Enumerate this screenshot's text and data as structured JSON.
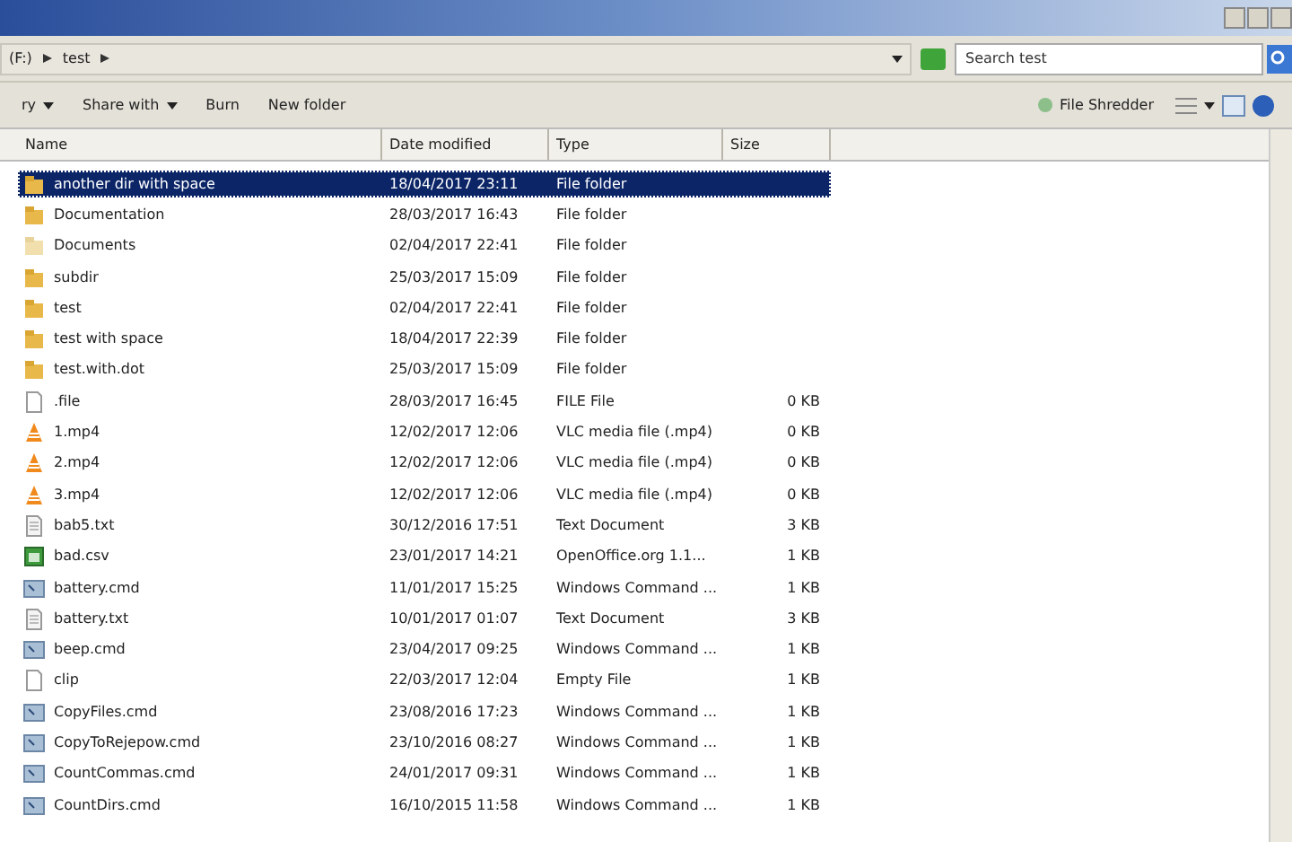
{
  "address": {
    "segments": [
      "(F:)",
      "test"
    ]
  },
  "search": {
    "placeholder": "Search test"
  },
  "toolbar": {
    "left": [
      {
        "label": "ry",
        "dropdown": true
      },
      {
        "label": "Share with",
        "dropdown": true
      },
      {
        "label": "Burn",
        "dropdown": false
      },
      {
        "label": "New folder",
        "dropdown": false
      }
    ],
    "right_label": "File Shredder"
  },
  "columns": [
    "Name",
    "Date modified",
    "Type",
    "Size"
  ],
  "rows": [
    {
      "kind": "folder",
      "name": "another dir with space",
      "date": "18/04/2017 23:11",
      "type": "File folder",
      "selected": true
    },
    {
      "kind": "folder",
      "name": "Documentation",
      "date": "28/03/2017 16:43",
      "type": "File folder",
      "selected": false
    },
    {
      "kind": "folder-light",
      "name": "Documents",
      "date": "02/04/2017 22:41",
      "type": "File folder",
      "selected": false
    },
    {
      "kind": "folder",
      "name": "subdir",
      "date": "25/03/2017 15:09",
      "type": "File folder",
      "selected": false
    },
    {
      "kind": "folder",
      "name": "test",
      "date": "02/04/2017 22:41",
      "type": "File folder",
      "selected": false
    },
    {
      "kind": "folder",
      "name": "test with space",
      "date": "18/04/2017 22:39",
      "type": "File folder",
      "selected": false
    },
    {
      "kind": "folder",
      "name": "test.with.dot",
      "date": "25/03/2017 15:09",
      "type": "File folder",
      "selected": false
    },
    {
      "kind": "file",
      "name": ".file",
      "date": "28/03/2017 16:45",
      "type": "FILE File",
      "size": "0 KB",
      "selected": false
    },
    {
      "kind": "video",
      "name": "1.mp4",
      "date": "12/02/2017 12:06",
      "type": "VLC media file (.mp4)",
      "size": "0 KB",
      "selected": false
    },
    {
      "kind": "video",
      "name": "2.mp4",
      "date": "12/02/2017 12:06",
      "type": "VLC media file (.mp4)",
      "size": "0 KB",
      "selected": false
    },
    {
      "kind": "video",
      "name": "3.mp4",
      "date": "12/02/2017 12:06",
      "type": "VLC media file (.mp4)",
      "size": "0 KB",
      "selected": false
    },
    {
      "kind": "text",
      "name": "bab5.txt",
      "date": "30/12/2016 17:51",
      "type": "Text Document",
      "size": "3 KB",
      "selected": false
    },
    {
      "kind": "spreadsheet",
      "name": "bad.csv",
      "date": "23/01/2017 14:21",
      "type": "OpenOffice.org 1.1...",
      "size": "1 KB",
      "selected": false
    },
    {
      "kind": "script",
      "name": "battery.cmd",
      "date": "11/01/2017 15:25",
      "type": "Windows Command ...",
      "size": "1 KB",
      "selected": false
    },
    {
      "kind": "text",
      "name": "battery.txt",
      "date": "10/01/2017 01:07",
      "type": "Text Document",
      "size": "3 KB",
      "selected": false
    },
    {
      "kind": "script",
      "name": "beep.cmd",
      "date": "23/04/2017 09:25",
      "type": "Windows Command ...",
      "size": "1 KB",
      "selected": false
    },
    {
      "kind": "file",
      "name": "clip",
      "date": "22/03/2017 12:04",
      "type": "Empty File",
      "size": "1 KB",
      "selected": false
    },
    {
      "kind": "script",
      "name": "CopyFiles.cmd",
      "date": "23/08/2016 17:23",
      "type": "Windows Command ...",
      "size": "1 KB",
      "selected": false
    },
    {
      "kind": "script",
      "name": "CopyToRejepow.cmd",
      "date": "23/10/2016 08:27",
      "type": "Windows Command ...",
      "size": "1 KB",
      "selected": false
    },
    {
      "kind": "script",
      "name": "CountCommas.cmd",
      "date": "24/01/2017 09:31",
      "type": "Windows Command ...",
      "size": "1 KB",
      "selected": false
    },
    {
      "kind": "script",
      "name": "CountDirs.cmd",
      "date": "16/10/2015 11:58",
      "type": "Windows Command ...",
      "size": "1 KB",
      "selected": false
    }
  ]
}
